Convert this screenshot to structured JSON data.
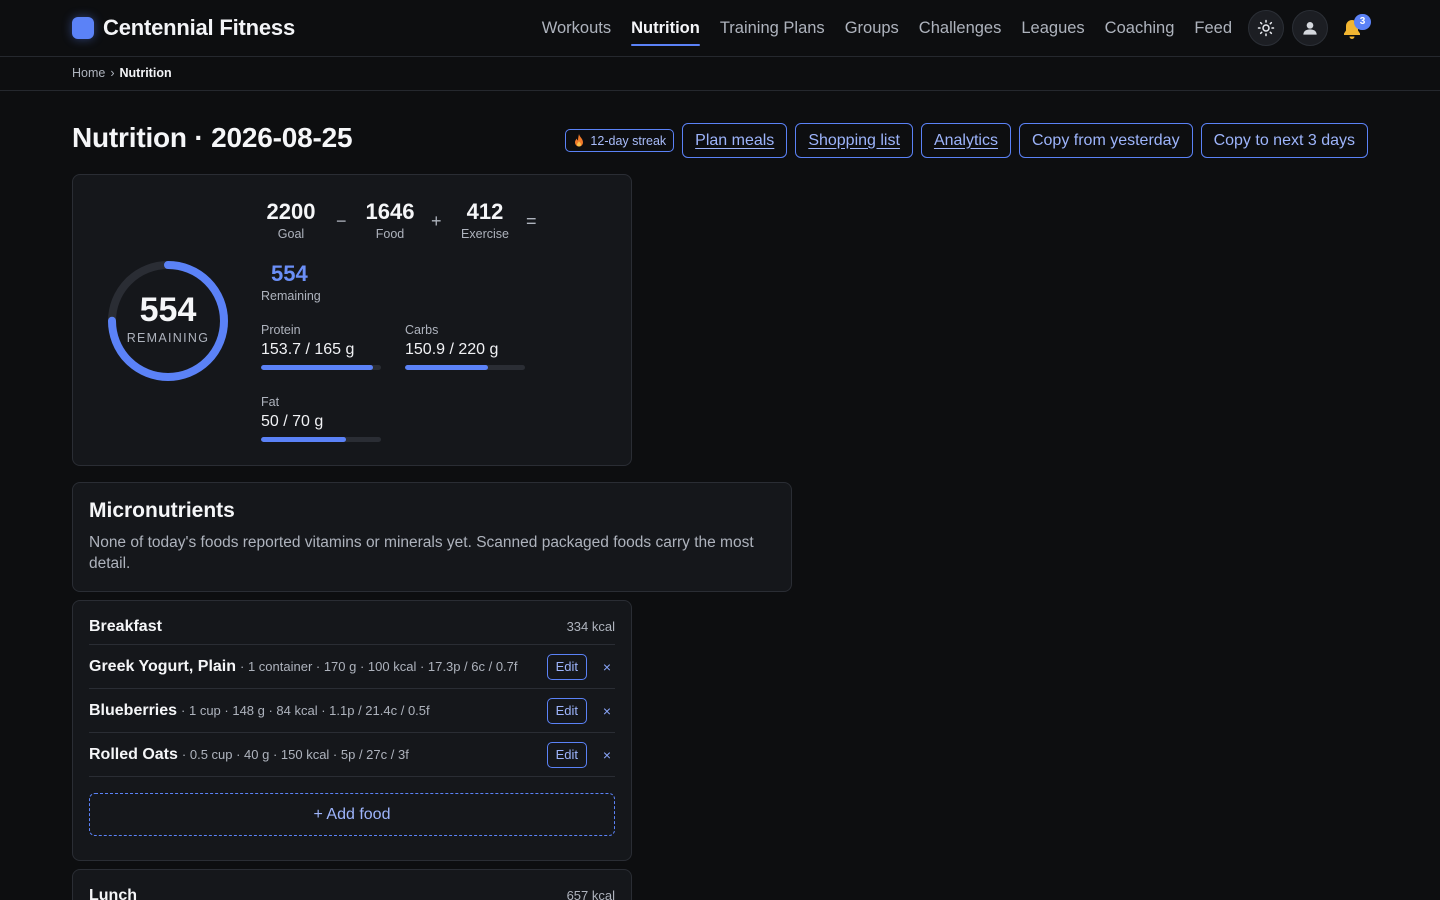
{
  "app": {
    "brand": "Centennial Fitness"
  },
  "nav": {
    "items": [
      "Workouts",
      "Nutrition",
      "Training Plans",
      "Groups",
      "Challenges",
      "Leagues",
      "Coaching",
      "Feed"
    ],
    "active": "Nutrition",
    "notification_count": "3"
  },
  "breadcrumb": {
    "home": "Home",
    "separator": "›",
    "current": "Nutrition"
  },
  "page": {
    "title": "Nutrition · 2026-08-25"
  },
  "actions": {
    "streak": "12-day streak",
    "plan_meals": "Plan meals",
    "shopping_list": "Shopping list",
    "analytics": "Analytics",
    "copy_yesterday": "Copy from yesterday",
    "copy_next": "Copy to next 3 days"
  },
  "summary": {
    "ring_value": "554",
    "ring_label": "REMAINING",
    "ring_progress": 0.75,
    "goal": "2200",
    "goal_label": "Goal",
    "minus": "−",
    "food": "1646",
    "food_label": "Food",
    "plus": "+",
    "exercise": "412",
    "exercise_label": "Exercise",
    "equals": "=",
    "remaining": "554",
    "remaining_label": "Remaining",
    "macros": [
      {
        "label": "Protein",
        "value": "153.7 / 165 g",
        "progress": 0.93
      },
      {
        "label": "Carbs",
        "value": "150.9 / 220 g",
        "progress": 0.69
      },
      {
        "label": "Fat",
        "value": "50 / 70 g",
        "progress": 0.71
      }
    ]
  },
  "micronutrients": {
    "title": "Micronutrients",
    "message": "None of today's foods reported vitamins or minerals yet. Scanned packaged foods carry the most detail."
  },
  "meals": {
    "breakfast": {
      "name": "Breakfast",
      "kcal": "334 kcal",
      "items": [
        {
          "name": "Greek Yogurt, Plain",
          "meta": "· 1 container · 170 g · 100 kcal · 17.3p / 6c / 0.7f"
        },
        {
          "name": "Blueberries",
          "meta": "· 1 cup · 148 g · 84 kcal · 1.1p / 21.4c / 0.5f"
        },
        {
          "name": "Rolled Oats",
          "meta": "· 0.5 cup · 40 g · 150 kcal · 5p / 27c / 3f"
        }
      ],
      "edit_label": "Edit",
      "remove_label": "×",
      "add_label": "+ Add food"
    },
    "lunch": {
      "name": "Lunch",
      "kcal": "657 kcal"
    }
  },
  "colors": {
    "accent": "#5b82f7",
    "background": "#0d0e10",
    "card": "#15171b"
  }
}
